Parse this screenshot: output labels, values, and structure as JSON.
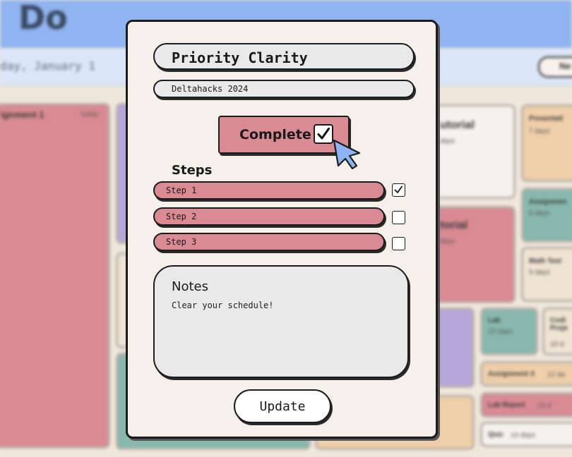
{
  "background": {
    "app_title": "Do",
    "date_text": "day, January 1",
    "header_button_label": "Ne",
    "tiles": [
      {
        "title": "ignment 1",
        "sub": "today"
      },
      {
        "title": "utorial",
        "sub": "days"
      },
      {
        "title": "Presentati",
        "sub": "7 days"
      },
      {
        "title": "torial",
        "sub": "days"
      },
      {
        "title": "Assignmen",
        "sub": "8 days"
      },
      {
        "title": "Math Test",
        "sub": "9 days"
      },
      {
        "title": "Lab",
        "sub": "10 days"
      },
      {
        "title": "Codi Proje",
        "sub": "10 d"
      },
      {
        "title": "Assignment 3",
        "sub": "12 da"
      },
      {
        "title": "Lab Report",
        "sub": "13 d"
      },
      {
        "title": "Quiz",
        "sub": "14 days"
      }
    ]
  },
  "modal": {
    "task_title": "Priority Clarity",
    "project": "Deltahacks 2024",
    "complete_label": "Complete",
    "complete_checked": true,
    "steps_heading": "Steps",
    "steps": [
      {
        "label": "Step 1",
        "checked": true
      },
      {
        "label": "Step 2",
        "checked": false
      },
      {
        "label": "Step 3",
        "checked": false
      }
    ],
    "notes_heading": "Notes",
    "notes_text": "Clear your schedule!",
    "update_label": "Update"
  },
  "colors": {
    "accent_pink": "#d98a93",
    "header_blue": "#90b4f0",
    "cursor_blue": "#8cb4f2"
  },
  "icons": {
    "complete_check": "check-icon",
    "pointer": "cursor-icon"
  }
}
